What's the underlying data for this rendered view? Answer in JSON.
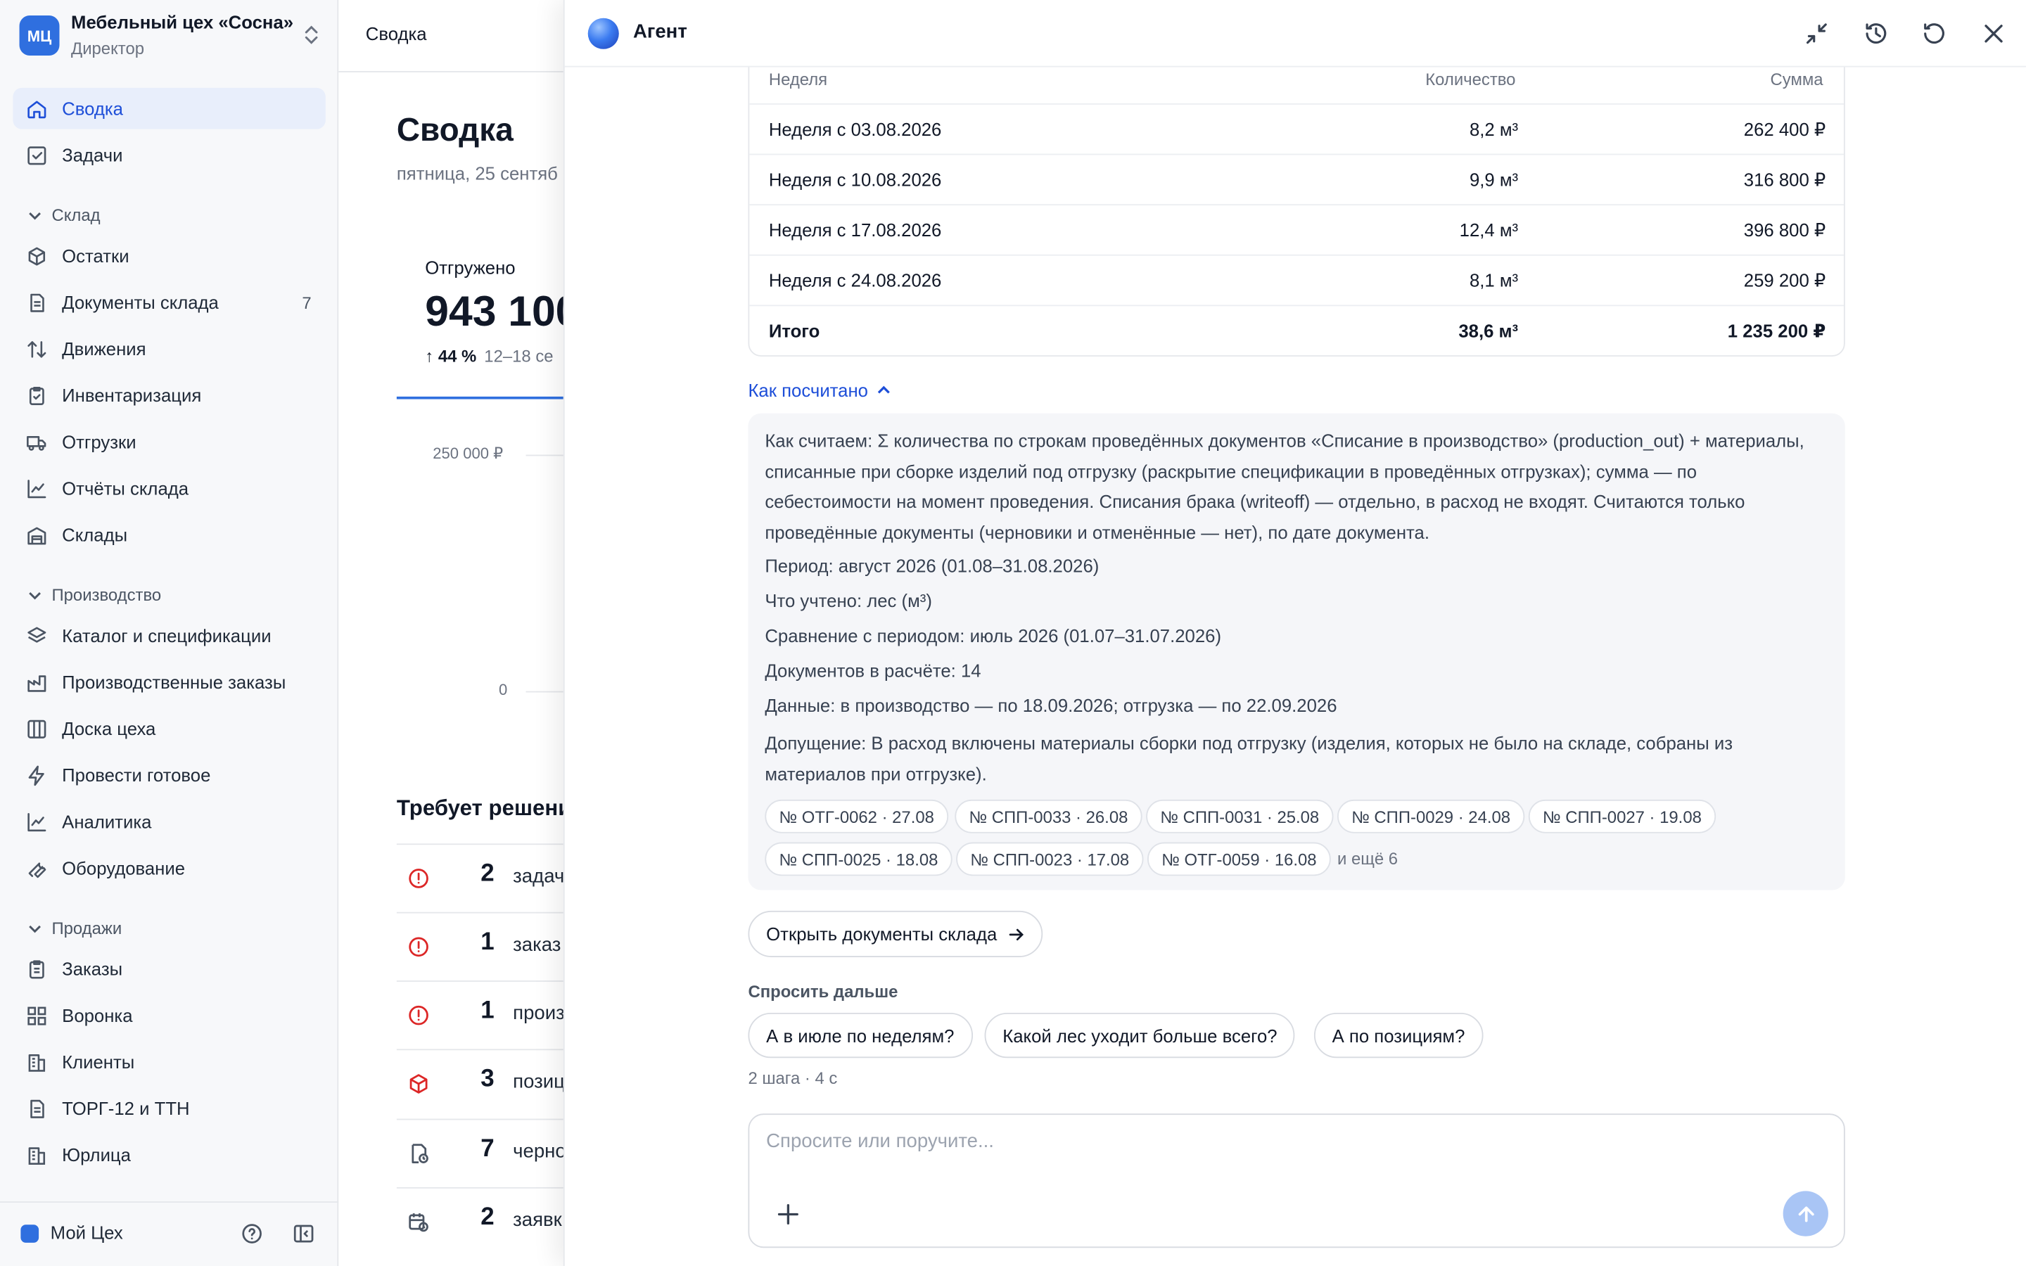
{
  "sidebar": {
    "org": {
      "logo": "МЦ",
      "name": "Мебельный цех «Сосна»",
      "role": "Директор"
    },
    "top_items": [
      {
        "label": "Сводка",
        "icon": "home-icon",
        "active": true
      },
      {
        "label": "Задачи",
        "icon": "checkbox-icon"
      }
    ],
    "sections": [
      {
        "label": "Склад",
        "items": [
          {
            "label": "Остатки",
            "icon": "package-icon"
          },
          {
            "label": "Документы склада",
            "icon": "document-icon",
            "count": "7"
          },
          {
            "label": "Движения",
            "icon": "arrows-updown-icon"
          },
          {
            "label": "Инвентаризация",
            "icon": "clipboard-check-icon"
          },
          {
            "label": "Отгрузки",
            "icon": "truck-icon"
          },
          {
            "label": "Отчёты склада",
            "icon": "line-chart-icon"
          },
          {
            "label": "Склады",
            "icon": "warehouse-icon"
          }
        ]
      },
      {
        "label": "Производство",
        "items": [
          {
            "label": "Каталог и спецификации",
            "icon": "layers-icon"
          },
          {
            "label": "Производственные заказы",
            "icon": "factory-icon"
          },
          {
            "label": "Доска цеха",
            "icon": "columns-icon"
          },
          {
            "label": "Провести готовое",
            "icon": "lightning-icon"
          },
          {
            "label": "Аналитика",
            "icon": "line-chart-icon"
          },
          {
            "label": "Оборудование",
            "icon": "wrench-icon"
          }
        ]
      },
      {
        "label": "Продажи",
        "items": [
          {
            "label": "Заказы",
            "icon": "clipboard-icon"
          },
          {
            "label": "Воронка",
            "icon": "grid-icon"
          },
          {
            "label": "Клиенты",
            "icon": "building-icon"
          },
          {
            "label": "ТОРГ-12 и ТТН",
            "icon": "document-icon"
          },
          {
            "label": "Юрлица",
            "icon": "building-icon"
          }
        ]
      }
    ],
    "footer": {
      "workspace": "Мой Цех"
    }
  },
  "main": {
    "topbar_title": "Сводка",
    "page_title": "Сводка",
    "date": "пятница, 25 сентяб",
    "kpi": {
      "label": "Отгружено",
      "value": "943 100",
      "delta": "↑ 44 %",
      "period": "12–18 се"
    },
    "chart_ticks": [
      "250 000 ₽",
      "0"
    ],
    "requires_title": "Требует решени",
    "requires": [
      {
        "num": "2",
        "text": "задач",
        "icon": "alert-circle-icon"
      },
      {
        "num": "1",
        "text": "заказ",
        "icon": "alert-circle-icon"
      },
      {
        "num": "1",
        "text": "произ",
        "icon": "alert-circle-icon"
      },
      {
        "num": "3",
        "text": "позиц",
        "icon": "box-alert-icon"
      },
      {
        "num": "7",
        "text": "черно",
        "icon": "doc-clock-icon"
      },
      {
        "num": "2",
        "text": "заявк",
        "icon": "calendar-clock-icon"
      }
    ]
  },
  "agent": {
    "title": "Агент",
    "table": {
      "headers": [
        "Неделя",
        "Количество",
        "Сумма"
      ],
      "rows": [
        [
          "Неделя с 03.08.2026",
          "8,2 м³",
          "262 400 ₽"
        ],
        [
          "Неделя с 10.08.2026",
          "9,9 м³",
          "316 800 ₽"
        ],
        [
          "Неделя с 17.08.2026",
          "12,4 м³",
          "396 800 ₽"
        ],
        [
          "Неделя с 24.08.2026",
          "8,1 м³",
          "259 200 ₽"
        ]
      ],
      "total": [
        "Итого",
        "38,6 м³",
        "1 235 200 ₽"
      ]
    },
    "how_label": "Как посчитано",
    "how": {
      "method": "Как считаем: Σ количества по строкам проведённых документов «Списание в производство» (production_out) + материалы, списанные при сборке изделий под отгрузку (раскрытие спецификации в проведённых отгрузках); сумма — по себестоимости на момент проведения. Списания брака (writeoff) — отдельно, в расход не входят. Считаются только проведённые документы (черновики и отменённые — нет), по дате документа.",
      "period": "Период: август 2026 (01.08–31.08.2026)",
      "counted": "Что учтено: лес (м³)",
      "compare": "Сравнение с периодом: июль 2026 (01.07–31.07.2026)",
      "docs": "Документов в расчёте: 14",
      "data": "Данные: в производство — по 18.09.2026; отгрузка — по 22.09.2026",
      "assumption": "Допущение: В расход включены материалы сборки под отгрузку (изделия, которых не было на складе, собраны из материалов при отгрузке).",
      "chips": [
        "№ ОТГ-0062 · 27.08",
        "№ СПП-0033 · 26.08",
        "№ СПП-0031 · 25.08",
        "№ СПП-0029 · 24.08",
        "№ СПП-0027 · 19.08",
        "№ СПП-0025 · 18.08",
        "№ СПП-0023 · 17.08",
        "№ ОТГ-0059 · 16.08"
      ],
      "more": "и ещё 6"
    },
    "open_docs_label": "Открыть документы склада",
    "ask_label": "Спросить дальше",
    "suggestions": [
      "А в июле по неделям?",
      "Какой лес уходит больше всего?",
      "А по позициям?"
    ],
    "steps": "2 шага · 4 с",
    "composer_placeholder": "Спросите или поручите..."
  },
  "colors": {
    "accent": "#2f6fdf",
    "link": "#1d4ed8",
    "danger": "#dc2626",
    "send": "#a9c5f5"
  }
}
